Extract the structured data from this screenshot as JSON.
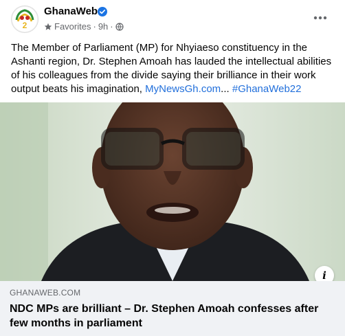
{
  "post": {
    "page_name": "GhanaWeb",
    "audience_label": "Favorites",
    "time": "9h",
    "separator": "·",
    "text": "The Member of Parliament (MP) for Nhyiaeso constituency in the Ashanti region, Dr. Stephen Amoah has lauded the intellectual abilities of his colleagues from the divide saying their brilliance in their work output beats his imagination,",
    "link_text": "MyNewsGh.com",
    "ellipsis": "...",
    "hashtag": "#GhanaWeb22"
  },
  "link_preview": {
    "domain": "GHANAWEB.COM",
    "headline": "NDC MPs are brilliant – Dr. Stephen Amoah confesses after few months in parliament"
  },
  "colors": {
    "link": "#216fdb",
    "verified": "#1b74e4",
    "secondary_text": "#65676b",
    "preview_bg": "#f0f2f5"
  },
  "icons": [
    "ghanaweb-logo-icon",
    "verified-badge-icon",
    "star-icon",
    "globe-icon",
    "more-options-icon",
    "info-icon"
  ]
}
